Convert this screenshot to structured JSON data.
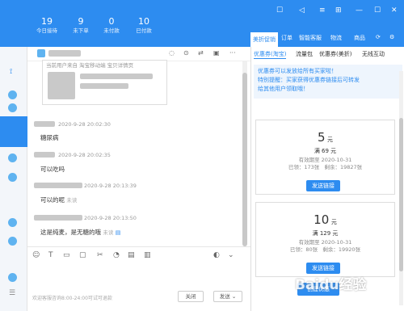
{
  "header": {
    "stats": [
      {
        "num": "19",
        "label": "今日接待"
      },
      {
        "num": "9",
        "label": "未下单"
      },
      {
        "num": "0",
        "label": "未付款"
      },
      {
        "num": "10",
        "label": "已付款"
      }
    ],
    "right_tabs": [
      "美折促销",
      "订单",
      "智能客服",
      "物流",
      "商品"
    ],
    "active_tab": "美折促销"
  },
  "chat": {
    "card_line": "当前用户来自 淘宝移动端 宝贝详情页",
    "messages": [
      {
        "time": "2020-9-28 20:02:30",
        "text": "糖尿病",
        "unread": ""
      },
      {
        "time": "2020-9-28 20:02:35",
        "text": "可以吃吗",
        "unread": ""
      },
      {
        "time": "2020-9-28 20:13:39",
        "text": "可以的呢",
        "unread": "未读"
      },
      {
        "time": "2020-9-28 20:13:50",
        "text": "这是纯麦，是无糖的哦",
        "unread": "未读"
      }
    ],
    "footer_hint": "欢迎客服咨询8:00-24:00可试可退款",
    "close_label": "关闭",
    "send_label": "发送"
  },
  "coupons_panel": {
    "subtabs": [
      "优惠券(淘宝)",
      "流量包",
      "优惠券(美折)",
      "无线互动"
    ],
    "notice_line1": "优惠券可以发放给所有买家啦！",
    "notice_line2": "特别提醒：买家获得优惠券链接后可转发",
    "notice_line3": "给其他用户领取哦！",
    "coupons": [
      {
        "amount": "5",
        "unit": "元",
        "condition": "满 69 元",
        "valid": "有效期至 2020-10-31",
        "used": "已领：173张",
        "remain": "剩余：19827张",
        "button": "发送链接"
      },
      {
        "amount": "10",
        "unit": "元",
        "condition": "满 129 元",
        "valid": "有效期至 2020-10-31",
        "used": "已领：80张",
        "remain": "剩余：19920张",
        "button": "发送链接"
      }
    ],
    "create_button": "创建优惠",
    "watermark": "Baidu经验"
  },
  "colors": {
    "accent": "#2d8cf0"
  }
}
